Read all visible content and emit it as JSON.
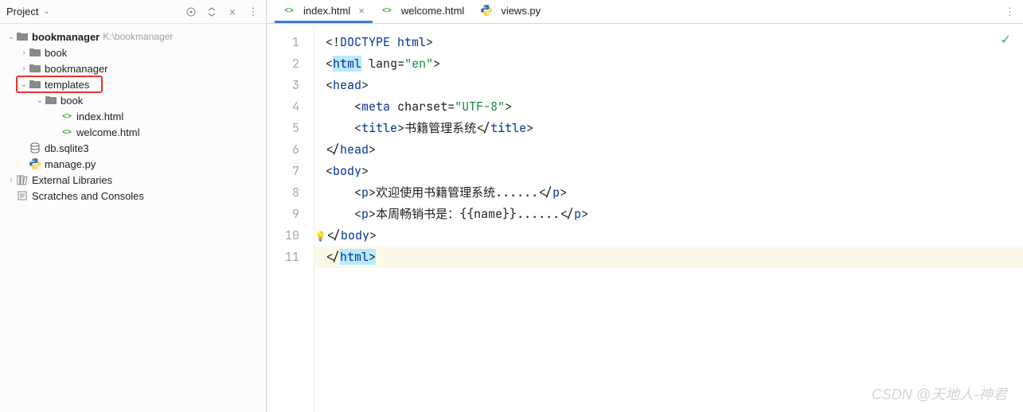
{
  "sidebar": {
    "title": "Project",
    "actions": [
      "target",
      "collapse",
      "hide",
      "more"
    ],
    "tree": {
      "root": {
        "name": "bookmanager",
        "path": "K:\\bookmanager",
        "expanded": true,
        "children": [
          {
            "name": "book",
            "type": "folder",
            "expanded": false
          },
          {
            "name": "bookmanager",
            "type": "folder",
            "expanded": false
          },
          {
            "name": "templates",
            "type": "folder",
            "expanded": true,
            "highlighted": true,
            "children": [
              {
                "name": "book",
                "type": "folder",
                "expanded": true,
                "children": [
                  {
                    "name": "index.html",
                    "type": "html"
                  },
                  {
                    "name": "welcome.html",
                    "type": "html"
                  }
                ]
              }
            ]
          },
          {
            "name": "db.sqlite3",
            "type": "db"
          },
          {
            "name": "manage.py",
            "type": "py"
          }
        ]
      },
      "extras": [
        {
          "name": "External Libraries",
          "icon": "libs"
        },
        {
          "name": "Scratches and Consoles",
          "icon": "scratches"
        }
      ]
    }
  },
  "tabs": [
    {
      "label": "index.html",
      "icon": "html",
      "active": true
    },
    {
      "label": "welcome.html",
      "icon": "html",
      "active": false
    },
    {
      "label": "views.py",
      "icon": "py",
      "active": false
    }
  ],
  "editor": {
    "currentLine": 11,
    "lines": [
      {
        "n": 1,
        "tokens": [
          [
            "punct",
            "<!"
          ],
          [
            "keyword",
            "DOCTYPE "
          ],
          [
            "tag-name",
            "html"
          ],
          [
            "punct",
            ">"
          ]
        ]
      },
      {
        "n": 2,
        "tokens": [
          [
            "punct",
            "<"
          ],
          [
            "tag-name hl",
            "html"
          ],
          [
            "text",
            " "
          ],
          [
            "attr",
            "lang"
          ],
          [
            "punct",
            "="
          ],
          [
            "string",
            "\"en\""
          ],
          [
            "punct",
            ">"
          ]
        ]
      },
      {
        "n": 3,
        "tokens": [
          [
            "punct",
            "<"
          ],
          [
            "tag-name",
            "head"
          ],
          [
            "punct",
            ">"
          ]
        ]
      },
      {
        "n": 4,
        "tokens": [
          [
            "text",
            "    "
          ],
          [
            "punct",
            "<"
          ],
          [
            "tag-name",
            "meta"
          ],
          [
            "text",
            " "
          ],
          [
            "attr",
            "charset"
          ],
          [
            "punct",
            "="
          ],
          [
            "string",
            "\"UTF-8\""
          ],
          [
            "punct",
            ">"
          ]
        ]
      },
      {
        "n": 5,
        "tokens": [
          [
            "text",
            "    "
          ],
          [
            "punct",
            "<"
          ],
          [
            "tag-name",
            "title"
          ],
          [
            "punct",
            ">"
          ],
          [
            "text",
            "书籍管理系统"
          ],
          [
            "punct",
            "</"
          ],
          [
            "tag-name",
            "title"
          ],
          [
            "punct",
            ">"
          ]
        ]
      },
      {
        "n": 6,
        "tokens": [
          [
            "punct",
            "</"
          ],
          [
            "tag-name",
            "head"
          ],
          [
            "punct",
            ">"
          ]
        ]
      },
      {
        "n": 7,
        "tokens": [
          [
            "punct",
            "<"
          ],
          [
            "tag-name",
            "body"
          ],
          [
            "punct",
            ">"
          ]
        ]
      },
      {
        "n": 8,
        "tokens": [
          [
            "text",
            "    "
          ],
          [
            "punct",
            "<"
          ],
          [
            "tag-name",
            "p"
          ],
          [
            "punct",
            ">"
          ],
          [
            "text",
            "欢迎使用书籍管理系统......"
          ],
          [
            "punct",
            "</"
          ],
          [
            "tag-name",
            "p"
          ],
          [
            "punct",
            ">"
          ]
        ]
      },
      {
        "n": 9,
        "tokens": [
          [
            "text",
            "    "
          ],
          [
            "punct",
            "<"
          ],
          [
            "tag-name",
            "p"
          ],
          [
            "punct",
            ">"
          ],
          [
            "text",
            "本周畅销书是：{{name}}......"
          ],
          [
            "punct",
            "</"
          ],
          [
            "tag-name",
            "p"
          ],
          [
            "punct",
            ">"
          ]
        ]
      },
      {
        "n": 10,
        "bulb": true,
        "tokens": [
          [
            "punct",
            "</"
          ],
          [
            "tag-name",
            "body"
          ],
          [
            "punct",
            ">"
          ]
        ]
      },
      {
        "n": 11,
        "tokens": [
          [
            "punct",
            "</"
          ],
          [
            "tag-name hl",
            "html"
          ],
          [
            "punct hl",
            ">"
          ]
        ]
      }
    ]
  },
  "watermark": "CSDN @天地人-神君"
}
